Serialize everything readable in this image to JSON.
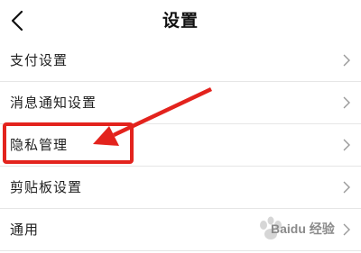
{
  "header": {
    "title": "设置",
    "back_icon": "chevron-left-icon"
  },
  "settings": {
    "items": [
      {
        "label": "支付设置"
      },
      {
        "label": "消息通知设置"
      },
      {
        "label": "隐私管理",
        "highlighted": true
      },
      {
        "label": "剪贴板设置"
      },
      {
        "label": "通用"
      }
    ],
    "chevron_icon": "chevron-right-icon"
  },
  "annotation": {
    "color": "#e3231d",
    "arrow_icon": "annotation-arrow"
  },
  "watermark": {
    "text": "Baidu 经验"
  }
}
